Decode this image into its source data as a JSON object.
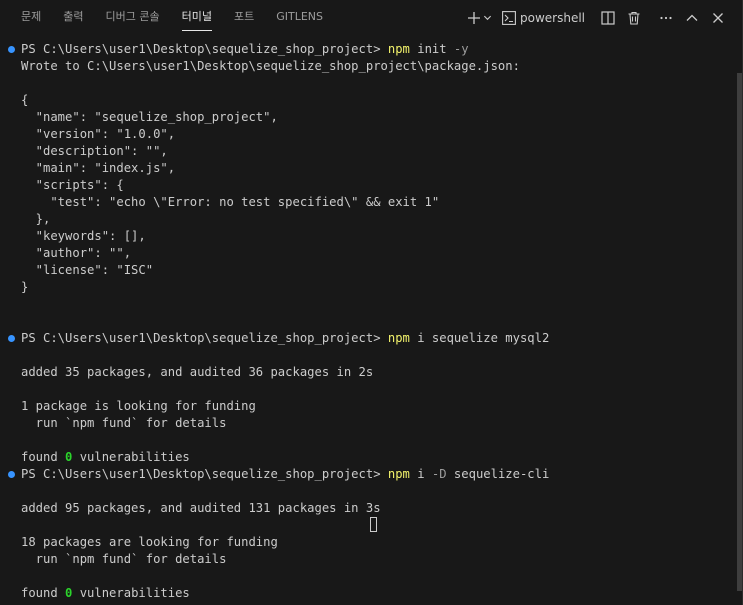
{
  "panel": {
    "tabs": [
      {
        "label": "문제"
      },
      {
        "label": "출력"
      },
      {
        "label": "디버그 콘솔"
      },
      {
        "label": "터미널",
        "active": true
      },
      {
        "label": "포트"
      },
      {
        "label": "GITLENS"
      }
    ],
    "shell_label": "powershell",
    "icons": [
      "plus-icon",
      "chevron-down-icon",
      "terminal-icon",
      "split-icon",
      "trash-icon",
      "ellipsis-icon",
      "chevron-up-icon",
      "close-icon"
    ]
  },
  "colors": {
    "background": "#181818",
    "text": "#cccccc",
    "command": "#f1f16b",
    "flag": "#9d9d9d",
    "success": "#2bd42b",
    "prompt_decoration": "#3794ff"
  },
  "terminal": {
    "lines": [
      {
        "type": "prompt",
        "prompt": "PS C:\\Users\\user1\\Desktop\\sequelize_shop_project> ",
        "cmd": "npm",
        "args": " init ",
        "flag": "-y",
        "rest": ""
      },
      {
        "type": "text",
        "text": "Wrote to C:\\Users\\user1\\Desktop\\sequelize_shop_project\\package.json:"
      },
      {
        "type": "text",
        "text": ""
      },
      {
        "type": "text",
        "text": "{"
      },
      {
        "type": "text",
        "text": "  \"name\": \"sequelize_shop_project\","
      },
      {
        "type": "text",
        "text": "  \"version\": \"1.0.0\","
      },
      {
        "type": "text",
        "text": "  \"description\": \"\","
      },
      {
        "type": "text",
        "text": "  \"main\": \"index.js\","
      },
      {
        "type": "text",
        "text": "  \"scripts\": {"
      },
      {
        "type": "text",
        "text": "    \"test\": \"echo \\\"Error: no test specified\\\" && exit 1\""
      },
      {
        "type": "text",
        "text": "  },"
      },
      {
        "type": "text",
        "text": "  \"keywords\": [],"
      },
      {
        "type": "text",
        "text": "  \"author\": \"\","
      },
      {
        "type": "text",
        "text": "  \"license\": \"ISC\""
      },
      {
        "type": "text",
        "text": "}"
      },
      {
        "type": "text",
        "text": ""
      },
      {
        "type": "text",
        "text": ""
      },
      {
        "type": "prompt",
        "prompt": "PS C:\\Users\\user1\\Desktop\\sequelize_shop_project> ",
        "cmd": "npm",
        "args": " i sequelize mysql2",
        "flag": "",
        "rest": ""
      },
      {
        "type": "text",
        "text": ""
      },
      {
        "type": "text",
        "text": "added 35 packages, and audited 36 packages in 2s"
      },
      {
        "type": "text",
        "text": ""
      },
      {
        "type": "text",
        "text": "1 package is looking for funding"
      },
      {
        "type": "text",
        "text": "  run `npm fund` for details"
      },
      {
        "type": "text",
        "text": ""
      },
      {
        "type": "found",
        "before": "found ",
        "count": "0",
        "after": " vulnerabilities"
      },
      {
        "type": "prompt",
        "prompt": "PS C:\\Users\\user1\\Desktop\\sequelize_shop_project> ",
        "cmd": "npm",
        "args": " i ",
        "flag": "-D",
        "rest": " sequelize-cli"
      },
      {
        "type": "text",
        "text": ""
      },
      {
        "type": "text",
        "text": "added 95 packages, and audited 131 packages in 3s"
      },
      {
        "type": "text",
        "text": ""
      },
      {
        "type": "text",
        "text": "18 packages are looking for funding"
      },
      {
        "type": "text",
        "text": "  run `npm fund` for details"
      },
      {
        "type": "text",
        "text": ""
      },
      {
        "type": "found",
        "before": "found ",
        "count": "0",
        "after": " vulnerabilities"
      }
    ]
  }
}
